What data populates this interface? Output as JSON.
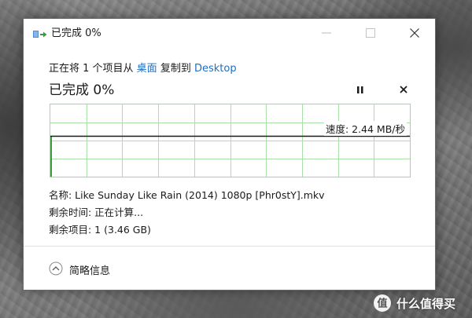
{
  "window": {
    "title": "已完成 0%",
    "icon": "copy-files-icon",
    "buttons": [
      "minimize-icon",
      "maximize-icon",
      "close-icon"
    ]
  },
  "copy": {
    "prefix": "正在将 1 个项目从 ",
    "source": "桌面",
    "middle": " 复制到 ",
    "destination": "Desktop",
    "progress_title": "已完成 0%",
    "progress": 0,
    "pause_icon": "pause-icon",
    "stop_icon": "stop-icon"
  },
  "graph": {
    "speed_text": "速度: 2.44 MB/秒",
    "grid_color": "#a8e0a8",
    "line_color": "#1a1a1a",
    "fill_color": "#3c9e3c"
  },
  "details": {
    "name_text": "名称: Like Sunday Like Rain (2014) 1080p [Phr0stY].mkv",
    "time_text": "剩余时间: 正在计算...",
    "items_text": "剩余项目: 1 (3.46 GB)"
  },
  "footer": {
    "toggle_label": "简略信息",
    "toggle_icon": "chevron-up-circle-icon"
  },
  "watermark": {
    "text": "什么值得买",
    "logo_char": "值"
  },
  "colors": {
    "accent": "#1e6fbf",
    "window_border": "#2b78c8"
  }
}
